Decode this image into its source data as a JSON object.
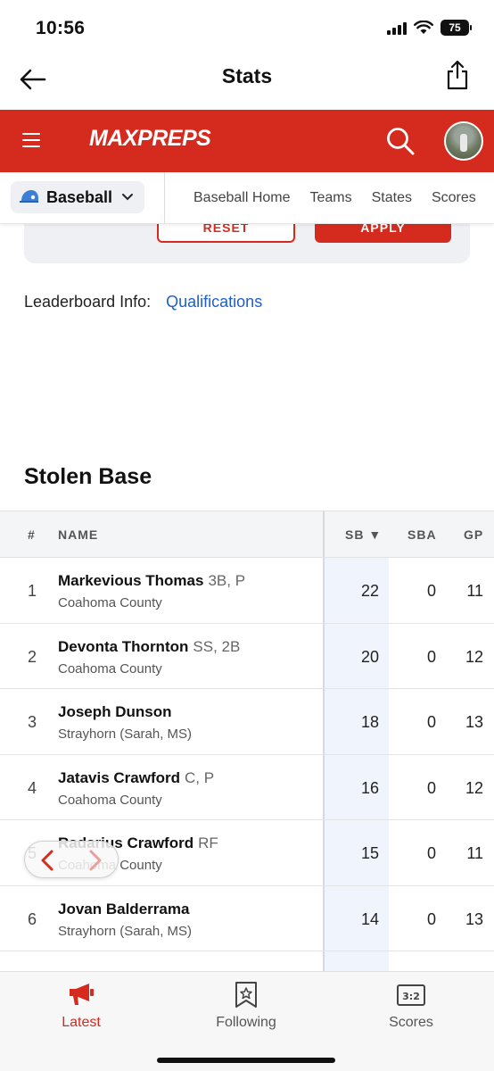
{
  "status_bar": {
    "time": "10:56",
    "battery": "75"
  },
  "header": {
    "title": "Stats"
  },
  "brand": {
    "logo": "MAXPREPS"
  },
  "sport_nav": {
    "sport": "Baseball",
    "links": [
      "Baseball Home",
      "Teams",
      "States",
      "Scores"
    ]
  },
  "filters": {
    "reset_label": "RESET",
    "apply_label": "APPLY"
  },
  "leaderboard": {
    "info_label": "Leaderboard Info:",
    "qualifications_link": "Qualifications"
  },
  "section_title": "Stolen Base",
  "table": {
    "headers": {
      "rank": "#",
      "name": "NAME",
      "sb": "SB ▼",
      "sba": "SBA",
      "gp": "GP"
    },
    "rows": [
      {
        "rank": "1",
        "name": "Markevious Thomas",
        "pos": "3B, P",
        "school": "Coahoma County",
        "sb": "22",
        "sba": "0",
        "gp": "11"
      },
      {
        "rank": "2",
        "name": "Devonta Thornton",
        "pos": "SS, 2B",
        "school": "Coahoma County",
        "sb": "20",
        "sba": "0",
        "gp": "12"
      },
      {
        "rank": "3",
        "name": "Joseph Dunson",
        "pos": "",
        "school": "Strayhorn (Sarah, MS)",
        "sb": "18",
        "sba": "0",
        "gp": "13"
      },
      {
        "rank": "4",
        "name": "Jatavis Crawford",
        "pos": "C, P",
        "school": "Coahoma County",
        "sb": "16",
        "sba": "0",
        "gp": "12"
      },
      {
        "rank": "5",
        "name": "Radarius Crawford",
        "pos": "RF",
        "school": "Coahoma County",
        "sb": "15",
        "sba": "0",
        "gp": "11"
      },
      {
        "rank": "6",
        "name": "Jovan Balderrama",
        "pos": "",
        "school": "Strayhorn (Sarah, MS)",
        "sb": "14",
        "sba": "0",
        "gp": "13"
      }
    ]
  },
  "tab_bar": {
    "latest": "Latest",
    "following": "Following",
    "scores": "Scores"
  },
  "colors": {
    "brand_red": "#d52b1e",
    "link_blue": "#1f5ecf",
    "sb_column": "#f0f4fc"
  }
}
